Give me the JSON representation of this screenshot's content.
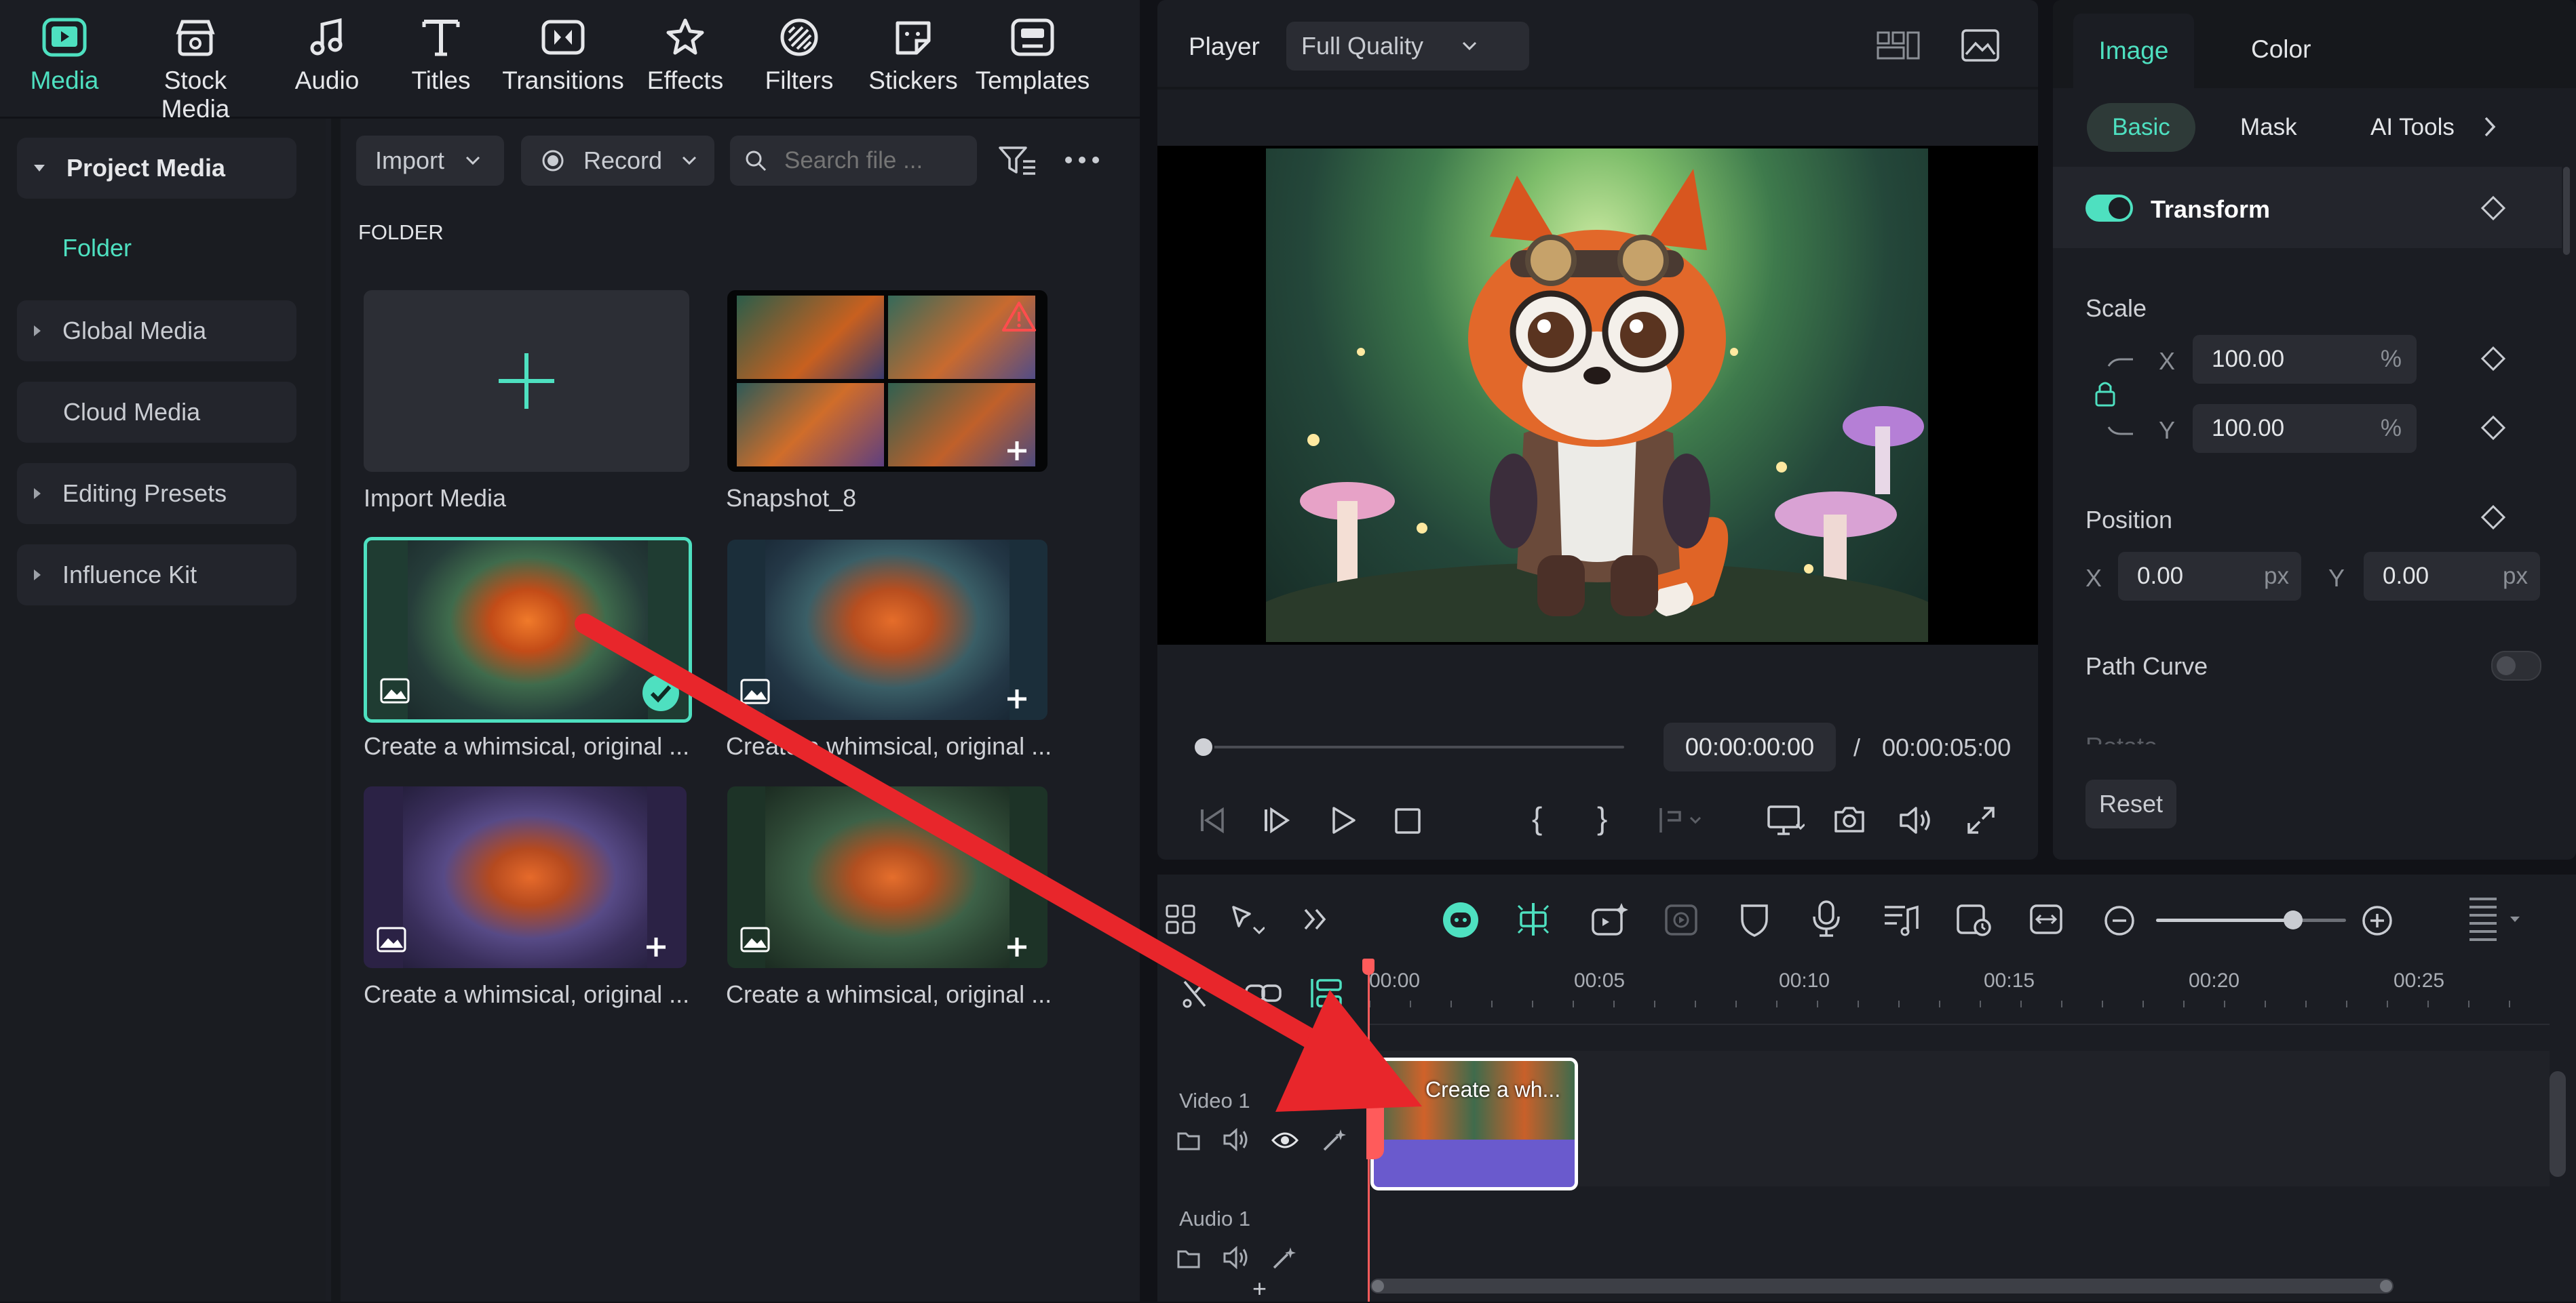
{
  "toolbar": {
    "items": [
      {
        "label": "Media",
        "icon": "media-icon"
      },
      {
        "label": "Stock Media",
        "icon": "stock-media-icon"
      },
      {
        "label": "Audio",
        "icon": "audio-icon"
      },
      {
        "label": "Titles",
        "icon": "titles-icon"
      },
      {
        "label": "Transitions",
        "icon": "transitions-icon"
      },
      {
        "label": "Effects",
        "icon": "effects-icon"
      },
      {
        "label": "Filters",
        "icon": "filters-icon"
      },
      {
        "label": "Stickers",
        "icon": "stickers-icon"
      },
      {
        "label": "Templates",
        "icon": "templates-icon"
      }
    ]
  },
  "sidebar": {
    "items": [
      {
        "label": "Project Media"
      },
      {
        "label": "Folder"
      },
      {
        "label": "Global Media"
      },
      {
        "label": "Cloud Media"
      },
      {
        "label": "Editing Presets"
      },
      {
        "label": "Influence Kit"
      }
    ]
  },
  "media": {
    "import_label": "Import",
    "record_label": "Record",
    "search_placeholder": "Search file ...",
    "section_title": "FOLDER",
    "items": [
      {
        "caption": "Import Media"
      },
      {
        "caption": "Snapshot_8"
      },
      {
        "caption": "Create a whimsical, original ..."
      },
      {
        "caption": "Create a whimsical, original ..."
      },
      {
        "caption": "Create a whimsical, original ..."
      },
      {
        "caption": "Create a whimsical, original ..."
      }
    ]
  },
  "player": {
    "label": "Player",
    "quality": "Full Quality",
    "current_time": "00:00:00:00",
    "separator": "/",
    "total_time": "00:00:05:00",
    "progress": 0.0
  },
  "properties": {
    "tabs": [
      "Image",
      "Color"
    ],
    "subtabs": [
      "Basic",
      "Mask",
      "AI Tools"
    ],
    "transform_label": "Transform",
    "scale_label": "Scale",
    "scale_x_label": "X",
    "scale_x": "100.00",
    "scale_y_label": "Y",
    "scale_y": "100.00",
    "percent": "%",
    "position_label": "Position",
    "pos_x_label": "X",
    "pos_x": "0.00",
    "pos_y_label": "Y",
    "pos_y": "0.00",
    "px": "px",
    "path_curve_label": "Path Curve",
    "rotate_label": "Rotate",
    "reset_label": "Reset"
  },
  "timeline": {
    "ruler": [
      "00:00",
      "00:05",
      "00:10",
      "00:15",
      "00:20",
      "00:25"
    ],
    "tracks": [
      {
        "label": "Video 1"
      },
      {
        "label": "Audio 1"
      }
    ],
    "clip_label": "Create a wh...",
    "zoom_level": 0.72
  },
  "colors": {
    "accent": "#4ee0c0",
    "annotation_arrow": "#e8262b",
    "clip": "#6a5acd"
  }
}
